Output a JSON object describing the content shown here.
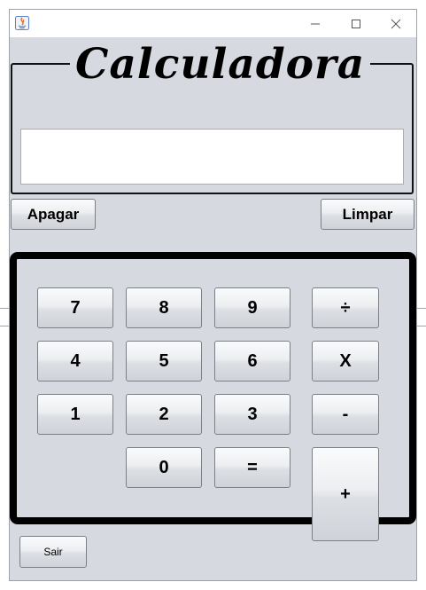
{
  "window": {
    "title": "",
    "controls": {
      "minimize": "─",
      "maximize": "☐",
      "close": "✕"
    }
  },
  "header": {
    "title": "Calculadora"
  },
  "display": {
    "value": "",
    "placeholder": ""
  },
  "actions": {
    "clear_last": "Apagar",
    "clear_all": "Limpar"
  },
  "keypad": {
    "k7": "7",
    "k8": "8",
    "k9": "9",
    "divide": "÷",
    "k4": "4",
    "k5": "5",
    "k6": "6",
    "multiply": "X",
    "k1": "1",
    "k2": "2",
    "k3": "3",
    "minus": "-",
    "k0": "0",
    "equals": "=",
    "plus": "+"
  },
  "footer": {
    "exit": "Sair"
  },
  "colors": {
    "window_bg": "#d6d9df",
    "panel_border": "#000000",
    "button_border": "#7b8087"
  }
}
